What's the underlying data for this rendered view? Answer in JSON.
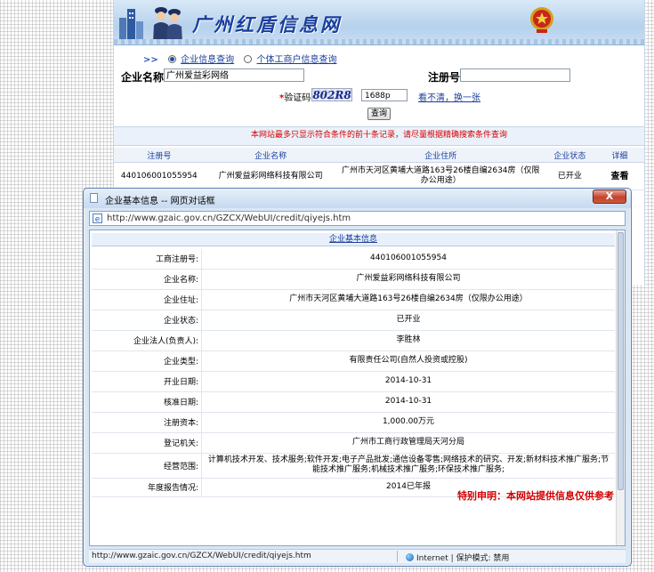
{
  "site": {
    "title": "广州红盾信息网",
    "radio_arrows": ">>",
    "radio_company": "企业信息查询",
    "radio_individual": "个体工商户信息查询",
    "name_label": "企业名称",
    "name_value": "广州爱益彩网络",
    "reg_label": "注册号",
    "captcha_label": "验证码",
    "captcha_star": "*",
    "captcha_image_text": "802R8",
    "captcha_value": "1688p",
    "captcha_refresh": "看不清，换一张",
    "query_button": "查询",
    "notice": "本网站最多只显示符合条件的前十条记录，请尽量根据精确搜索条件查询",
    "table_headers": [
      "注册号",
      "企业名称",
      "企业住所",
      "企业状态",
      "详细"
    ],
    "table_row": [
      "440106001055954",
      "广州爱益彩网络科技有限公司",
      "广州市天河区黄埔大道路163号26楼自编2634房（仅限办公用途）",
      "已开业",
      "查看"
    ]
  },
  "dialog": {
    "title": "企业基本信息 -- 网页对话框",
    "close": "X",
    "address": "http://www.gzaic.gov.cn/GZCX/WebUI/credit/qiyejs.htm",
    "section_title": "企业基本信息",
    "rows": [
      {
        "k": "工商注册号:",
        "v": "440106001055954"
      },
      {
        "k": "企业名称:",
        "v": "广州爱益彩网络科技有限公司"
      },
      {
        "k": "企业住址:",
        "v": "广州市天河区黄埔大道路163号26楼自编2634房（仅限办公用途）"
      },
      {
        "k": "企业状态:",
        "v": "已开业"
      },
      {
        "k": "企业法人(负责人):",
        "v": "李胜林"
      },
      {
        "k": "企业类型:",
        "v": "有限责任公司(自然人投资或控股)"
      },
      {
        "k": "开业日期:",
        "v": "2014-10-31"
      },
      {
        "k": "核准日期:",
        "v": "2014-10-31"
      },
      {
        "k": "注册资本:",
        "v": "1,000.00万元"
      },
      {
        "k": "登记机关:",
        "v": "广州市工商行政管理局天河分局"
      },
      {
        "k": "经营范围:",
        "v": "计算机技术开发、技术服务;软件开发;电子产品批发;通信设备零售;网络技术的研究、开发;新材料技术推广服务;节能技术推广服务;机械技术推广服务;环保技术推广服务;"
      },
      {
        "k": "年度报告情况:",
        "v": "2014已年报"
      }
    ],
    "special_notice": "特别申明：本网站提供信息仅供参考",
    "status_url": "http://www.gzaic.gov.cn/GZCX/WebUI/credit/qiyejs.htm",
    "status_zone": "Internet | 保护模式: 禁用"
  }
}
